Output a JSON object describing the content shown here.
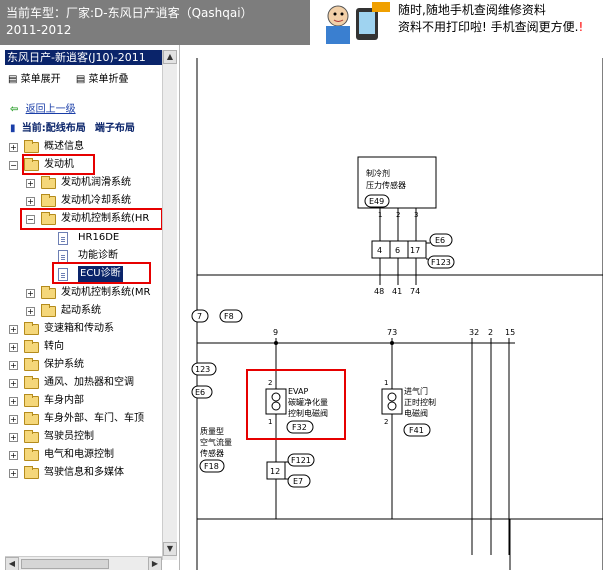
{
  "header": {
    "line1": "当前车型：厂家:D-东风日产逍客（Qashqai）",
    "line2": "2011-2012",
    "ad_line1": "随时,随地手机查阅维修资料",
    "ad_line2": "资料不用打印啦! 手机查阅更方便.",
    "ad_line2_tail": "!"
  },
  "sidebar": {
    "title": "东风日产-新逍客(J10)-2011",
    "expand_all": "菜单展开",
    "collapse_all": "菜单折叠",
    "back_link": "返回上一级",
    "current_label": "当前:配线布局",
    "current_sub": "端子布局",
    "tree": [
      {
        "label": "概述信息"
      },
      {
        "label": "发动机"
      },
      {
        "label": "发动机润滑系统"
      },
      {
        "label": "发动机冷却系统"
      },
      {
        "label": "发动机控制系统(HR"
      },
      {
        "label": "HR16DE"
      },
      {
        "label": "功能诊断"
      },
      {
        "label": "ECU诊断"
      },
      {
        "label": "发动机控制系统(MR"
      },
      {
        "label": "起动系统"
      },
      {
        "label": "变速箱和传动系"
      },
      {
        "label": "转向"
      },
      {
        "label": "保护系统"
      },
      {
        "label": "通风、加热器和空调"
      },
      {
        "label": "车身内部"
      },
      {
        "label": "车身外部、车门、车顶"
      },
      {
        "label": "驾驶员控制"
      },
      {
        "label": "电气和电源控制"
      },
      {
        "label": "驾驶信息和多媒体"
      }
    ]
  },
  "diagram": {
    "sensor_label_1": "制冷剂",
    "sensor_label_2": "压力传感器",
    "sensor_code": "E49",
    "pins_top": [
      "1",
      "2",
      "3"
    ],
    "conn_pins": [
      "4",
      "6",
      "17"
    ],
    "conn_code_e6": "E6",
    "conn_code_f123": "F123",
    "wire_nums": [
      "48",
      "41",
      "74"
    ],
    "left_tag_7": "7",
    "left_tag_f8": "F8",
    "num_9": "9",
    "num_73": "73",
    "num_32": "32",
    "num_2": "2",
    "num_15": "15",
    "tag_123": "123",
    "tag_e6b": "E6",
    "evap_1": "EVAP",
    "evap_2": "碳罐净化量",
    "evap_3": "控制电磁阀",
    "evap_code": "F32",
    "evap_pin_top": "2",
    "evap_pin_bottom": "1",
    "intake_1": "进气门",
    "intake_2": "正时控制",
    "intake_3": "电磁阀",
    "intake_code": "F41",
    "intake_pin_top": "1",
    "intake_pin_bottom": "2",
    "maf_1": "质量型",
    "maf_2": "空气流量",
    "maf_3": "传感器",
    "maf_code": "F18",
    "conn12": "12",
    "f121": "F121",
    "e7": "E7"
  }
}
